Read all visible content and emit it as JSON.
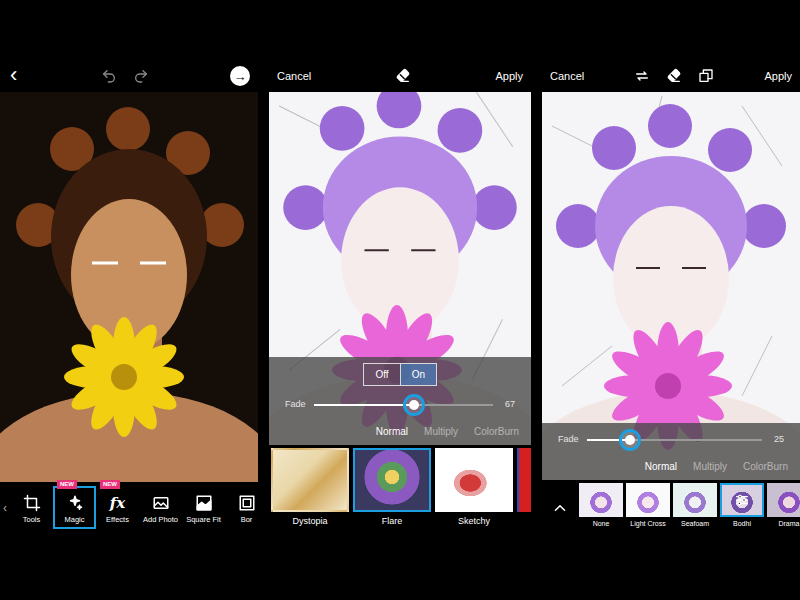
{
  "editor": {
    "top_bar": {
      "back": "‹",
      "next": "→"
    },
    "toolbar": {
      "scroll_hint": "‹",
      "items": [
        {
          "label": "Tools",
          "selected": false
        },
        {
          "label": "Magic",
          "badge": "NEW",
          "selected": true
        },
        {
          "label": "Effects",
          "badge": "NEW",
          "glyph": "fx",
          "selected": false
        },
        {
          "label": "Add Photo",
          "selected": false
        },
        {
          "label": "Square Fit",
          "selected": false
        },
        {
          "label": "Bor",
          "selected": false
        }
      ]
    }
  },
  "magic_screens": [
    {
      "cancel": "Cancel",
      "apply": "Apply",
      "toggle": [
        {
          "label": "Off",
          "selected": false
        },
        {
          "label": "On",
          "selected": true
        }
      ],
      "fade": {
        "label": "Fade",
        "level": 0.56,
        "reading": "67"
      },
      "blend_modes": [
        {
          "label": "Normal",
          "selected": true
        },
        {
          "label": "Multiply",
          "selected": false
        },
        {
          "label": "ColorBurn",
          "selected": false
        }
      ],
      "effects": [
        {
          "label": "Dystopia",
          "selected": false
        },
        {
          "label": "Flare",
          "selected": true
        },
        {
          "label": "Sketchy",
          "selected": false
        },
        {
          "selected": false
        }
      ]
    },
    {
      "cancel": "Cancel",
      "apply": "Apply",
      "fade": {
        "label": "Fade",
        "level": 0.25,
        "reading": "25"
      },
      "blend_modes": [
        {
          "label": "Normal",
          "selected": true
        },
        {
          "label": "Multiply",
          "selected": false
        },
        {
          "label": "ColorBurn",
          "selected": false
        }
      ],
      "effects": [
        {
          "label": "None",
          "selected": false
        },
        {
          "label": "Light Cross",
          "selected": false
        },
        {
          "label": "Seafoam",
          "selected": false
        },
        {
          "label": "Bodhi",
          "selected": true
        },
        {
          "label": "Drama",
          "selected": false
        }
      ]
    }
  ]
}
